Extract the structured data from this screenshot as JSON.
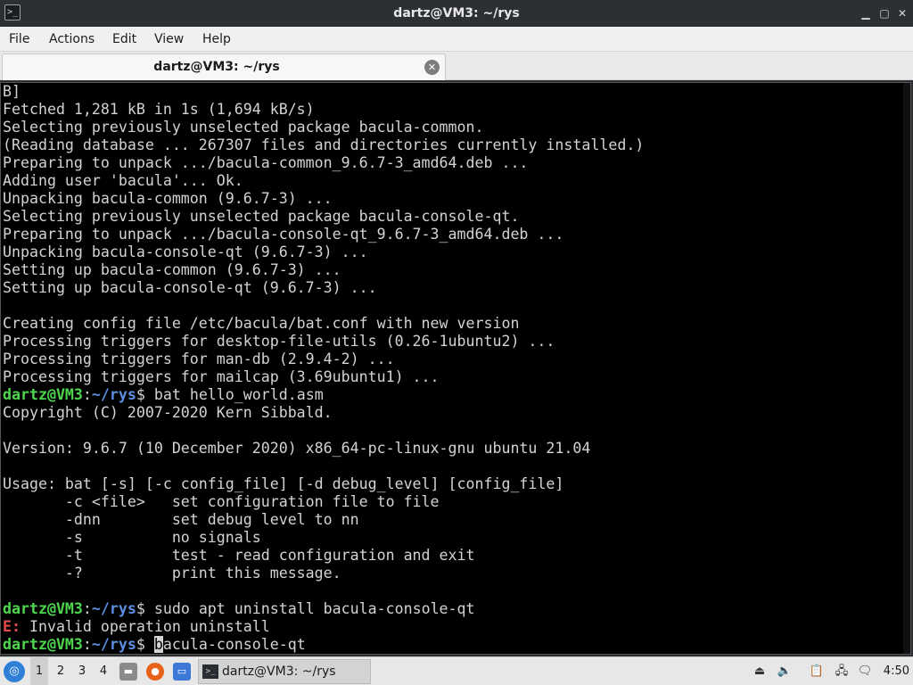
{
  "window": {
    "title": "dartz@VM3: ~/rys",
    "app_icon": "terminal-icon",
    "controls": {
      "minimize": "▁",
      "maximize": "▢",
      "close": "✕"
    }
  },
  "menubar": {
    "items": [
      "File",
      "Actions",
      "Edit",
      "View",
      "Help"
    ]
  },
  "tabs": [
    {
      "label": "dartz@VM3: ~/rys",
      "close_icon": "close-icon"
    }
  ],
  "terminal": {
    "prompt": {
      "user": "dartz@VM3",
      "sep": ":",
      "path": "~/rys",
      "symbol": "$"
    },
    "lines": [
      {
        "type": "text",
        "text": "B]"
      },
      {
        "type": "text",
        "text": "Fetched 1,281 kB in 1s (1,694 kB/s)"
      },
      {
        "type": "text",
        "text": "Selecting previously unselected package bacula-common."
      },
      {
        "type": "text",
        "text": "(Reading database ... 267307 files and directories currently installed.)"
      },
      {
        "type": "text",
        "text": "Preparing to unpack .../bacula-common_9.6.7-3_amd64.deb ..."
      },
      {
        "type": "text",
        "text": "Adding user 'bacula'... Ok."
      },
      {
        "type": "text",
        "text": "Unpacking bacula-common (9.6.7-3) ..."
      },
      {
        "type": "text",
        "text": "Selecting previously unselected package bacula-console-qt."
      },
      {
        "type": "text",
        "text": "Preparing to unpack .../bacula-console-qt_9.6.7-3_amd64.deb ..."
      },
      {
        "type": "text",
        "text": "Unpacking bacula-console-qt (9.6.7-3) ..."
      },
      {
        "type": "text",
        "text": "Setting up bacula-common (9.6.7-3) ..."
      },
      {
        "type": "text",
        "text": "Setting up bacula-console-qt (9.6.7-3) ..."
      },
      {
        "type": "text",
        "text": ""
      },
      {
        "type": "text",
        "text": "Creating config file /etc/bacula/bat.conf with new version"
      },
      {
        "type": "text",
        "text": "Processing triggers for desktop-file-utils (0.26-1ubuntu2) ..."
      },
      {
        "type": "text",
        "text": "Processing triggers for man-db (2.9.4-2) ..."
      },
      {
        "type": "text",
        "text": "Processing triggers for mailcap (3.69ubuntu1) ..."
      },
      {
        "type": "prompt",
        "cmd": " bat hello_world.asm"
      },
      {
        "type": "text",
        "text": "Copyright (C) 2007-2020 Kern Sibbald."
      },
      {
        "type": "text",
        "text": ""
      },
      {
        "type": "text",
        "text": "Version: 9.6.7 (10 December 2020) x86_64-pc-linux-gnu ubuntu 21.04"
      },
      {
        "type": "text",
        "text": ""
      },
      {
        "type": "text",
        "text": "Usage: bat [-s] [-c config_file] [-d debug_level] [config_file]"
      },
      {
        "type": "text",
        "text": "       -c <file>   set configuration file to file"
      },
      {
        "type": "text",
        "text": "       -dnn        set debug level to nn"
      },
      {
        "type": "text",
        "text": "       -s          no signals"
      },
      {
        "type": "text",
        "text": "       -t          test - read configuration and exit"
      },
      {
        "type": "text",
        "text": "       -?          print this message."
      },
      {
        "type": "text",
        "text": ""
      },
      {
        "type": "prompt",
        "cmd": " sudo apt uninstall bacula-console-qt"
      },
      {
        "type": "error",
        "prefix": "E:",
        "text": " Invalid operation uninstall"
      },
      {
        "type": "prompt_input",
        "pre": " ",
        "cursor_char": "b",
        "rest": "acula-console-qt"
      }
    ]
  },
  "taskbar": {
    "start_icon": "lubuntu-logo-icon",
    "workspaces": [
      "1",
      "2",
      "3",
      "4"
    ],
    "active_workspace": "1",
    "launchers": [
      "file-manager-icon",
      "firefox-icon",
      "desktop-icon"
    ],
    "task": {
      "label": "dartz@VM3: ~/rys",
      "icon": "terminal-icon"
    },
    "tray": [
      "eject-icon",
      "volume-icon",
      "clipboard-icon",
      "network-icon",
      "notification-icon"
    ],
    "clock": "4:50"
  }
}
